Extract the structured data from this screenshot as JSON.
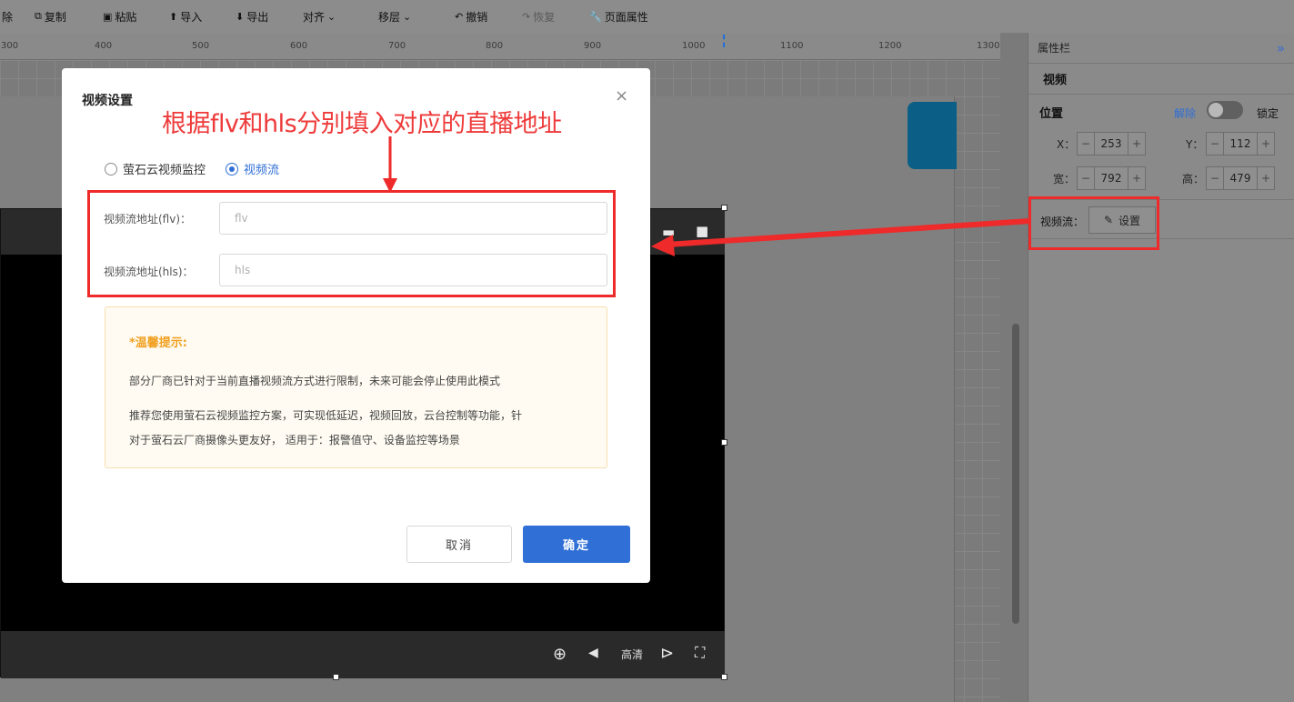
{
  "toolbar": {
    "items": [
      {
        "label": "除",
        "icon": "delete-icon"
      },
      {
        "label": "复制",
        "icon": "copy-icon"
      },
      {
        "label": "粘贴",
        "icon": "paste-icon"
      },
      {
        "label": "导入",
        "icon": "import-icon"
      },
      {
        "label": "导出",
        "icon": "export-icon"
      },
      {
        "label": "对齐",
        "icon": "chevron-down-icon"
      },
      {
        "label": "移层",
        "icon": "chevron-down-icon"
      },
      {
        "label": "撤销",
        "icon": "undo-icon"
      },
      {
        "label": "恢复",
        "icon": "redo-icon"
      },
      {
        "label": "页面属性",
        "icon": "wrench-icon"
      }
    ]
  },
  "ruler": {
    "labels": [
      "300",
      "400",
      "500",
      "600",
      "700",
      "800",
      "900",
      "1000",
      "1100",
      "1200",
      "1300"
    ]
  },
  "panel": {
    "title": "属性栏",
    "collapse_glyph": "»",
    "component": "视频",
    "position_label": "位置",
    "unlock_label": "解除",
    "lock_label": "锁定",
    "x_label": "X：",
    "x_value": "253",
    "y_label": "Y：",
    "y_value": "112",
    "w_label": "宽：",
    "w_value": "792",
    "h_label": "高：",
    "h_value": "479",
    "stream_label": "视频流：",
    "set_label": "设置"
  },
  "video": {
    "quality_label": "高清"
  },
  "annotation": {
    "text": "根据flv和hls分别填入对应的直播地址",
    "color": "#ee2a2a"
  },
  "modal": {
    "title": "视频设置",
    "close_glyph": "×",
    "radio_options": [
      "萤石云视频监控",
      "视频流"
    ],
    "selected_option": "视频流",
    "flv_label": "视频流地址(flv)：",
    "flv_placeholder": "flv",
    "hls_label": "视频流地址(hls)：",
    "hls_placeholder": "hls",
    "tip_title": "*温馨提示:",
    "tip_line1": "部分厂商已针对于当前直播视频流方式进行限制，未来可能会停止使用此模式",
    "tip_line2": "推荐您使用萤石云视频监控方案，可实现低延迟，视频回放，云台控制等功能，针",
    "tip_line3": "对于萤石云厂商摄像头更友好， 适用于：报警值守、设备监控等场景",
    "cancel_label": "取消",
    "ok_label": "确定",
    "primary_color": "#2f6fd6"
  }
}
